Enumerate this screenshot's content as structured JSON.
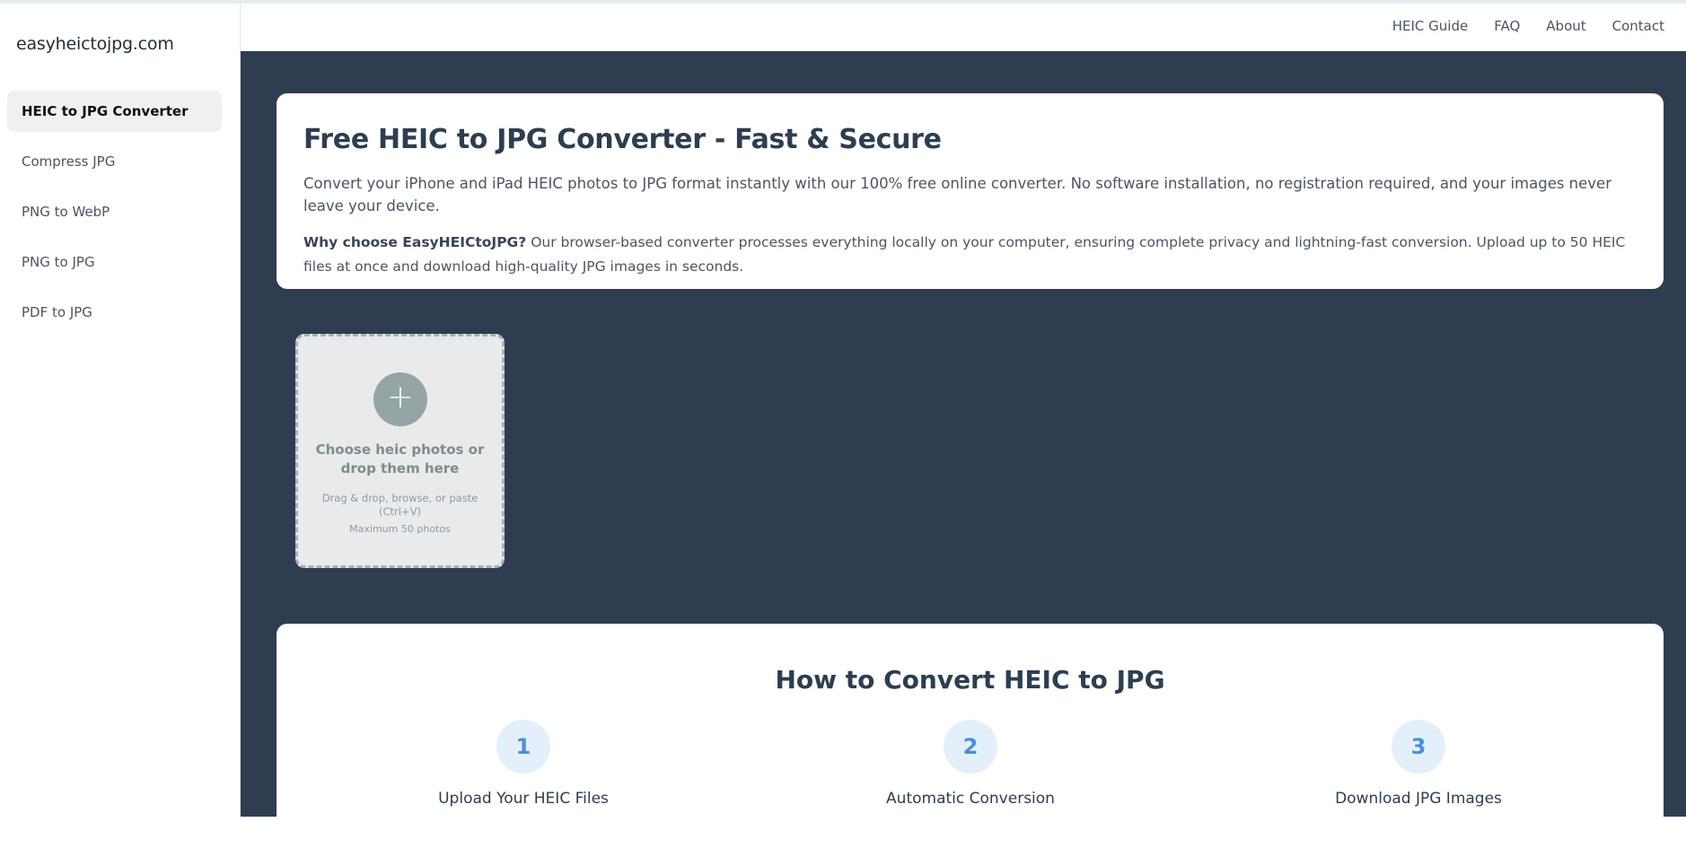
{
  "sidebar": {
    "brand": "easyheictojpg.com",
    "items": [
      {
        "label": "HEIC to JPG Converter",
        "active": true
      },
      {
        "label": "Compress JPG",
        "active": false
      },
      {
        "label": "PNG to WebP",
        "active": false
      },
      {
        "label": "PNG to JPG",
        "active": false
      },
      {
        "label": "PDF to JPG",
        "active": false
      }
    ]
  },
  "header": {
    "links": [
      "HEIC Guide",
      "FAQ",
      "About",
      "Contact"
    ]
  },
  "intro": {
    "title": "Free HEIC to JPG Converter - Fast & Secure",
    "text": "Convert your iPhone and iPad HEIC photos to JPG format instantly with our 100% free online converter. No software installation, no registration required, and your images never leave your device.",
    "why_label": "Why choose EasyHEICtoJPG?",
    "why_text": " Our browser-based converter processes everything locally on your computer, ensuring complete privacy and lightning-fast conversion. Upload up to 50 HEIC files at once and download high-quality JPG images in seconds."
  },
  "upload": {
    "icon": "plus-icon",
    "title": "Choose heic photos or drop them here",
    "hint": "Drag & drop, browse, or paste (Ctrl+V)",
    "max": "Maximum 50 photos"
  },
  "howto": {
    "title": "How to Convert HEIC to JPG",
    "steps": [
      {
        "num": "1",
        "title": "Upload Your HEIC Files"
      },
      {
        "num": "2",
        "title": "Automatic Conversion"
      },
      {
        "num": "3",
        "title": "Download JPG Images"
      }
    ]
  },
  "colors": {
    "main_bg": "#2e3e50",
    "accent": "#4a90d9",
    "upload_circle": "#95a5a6"
  }
}
